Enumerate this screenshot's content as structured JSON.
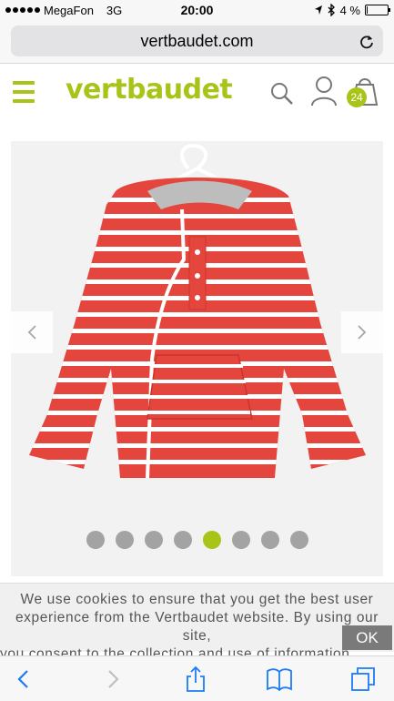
{
  "status_bar": {
    "carrier": "MegaFon",
    "network": "3G",
    "time": "20:00",
    "battery": "4 %",
    "battery_level": 0.04
  },
  "browser": {
    "address": "vertbaudet.com"
  },
  "site": {
    "logo": "vertbaudet",
    "cart_count": "24",
    "brand_color": "#a8c418"
  },
  "gallery": {
    "image_description_icon": "striped-red-raincoat-image",
    "slide_count": 8,
    "active_slide": 5
  },
  "cookie": {
    "line1": "We use cookies to ensure that you get the best user",
    "line2": "experience from the Vertbaudet website. By using our site,",
    "line3": "you consent to the collection and use of information.",
    "ok_label": "OK"
  },
  "icons": {
    "status": [
      "signal-dots-icon",
      "location-arrow-icon",
      "bluetooth-icon",
      "battery-icon"
    ],
    "header": [
      "menu-icon",
      "search-icon",
      "account-icon",
      "shopping-bag-icon"
    ],
    "toolbar": [
      "back-icon",
      "forward-icon",
      "share-icon",
      "bookmarks-icon",
      "tabs-icon"
    ]
  }
}
